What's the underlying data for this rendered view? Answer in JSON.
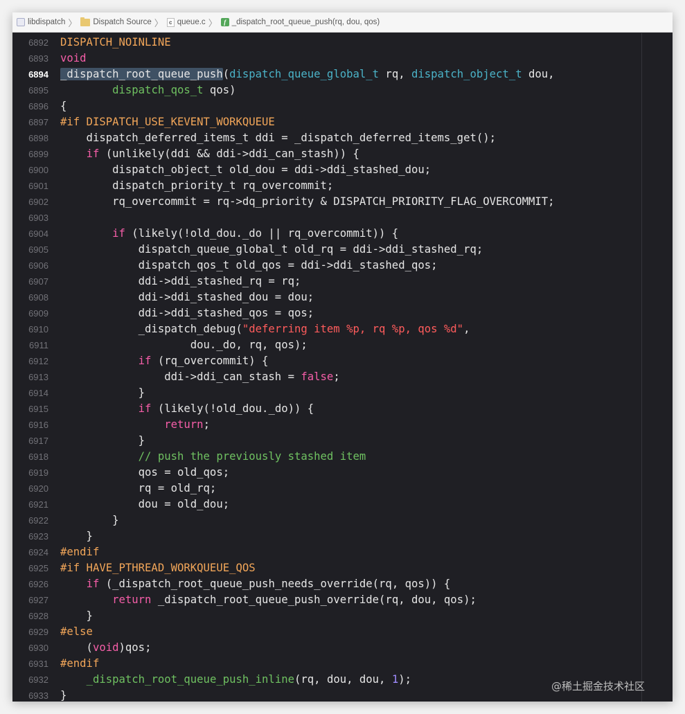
{
  "breadcrumb": {
    "items": [
      {
        "label": "libdispatch",
        "icon": "project-icon"
      },
      {
        "label": "Dispatch Source",
        "icon": "folder-icon"
      },
      {
        "label": "queue.c",
        "icon": "c-file-icon",
        "badge": "c"
      },
      {
        "label": "_dispatch_root_queue_push(rq, dou, qos)",
        "icon": "function-icon",
        "badge": "f"
      }
    ]
  },
  "colors": {
    "keyword": "#f55ea8",
    "preprocessor": "#f2a659",
    "string": "#ff5c5c",
    "comment": "#6fc161",
    "type": "#4bb3c8",
    "number": "#a08cff",
    "plain": "#e6e6e6",
    "background": "#1f1f24"
  },
  "editor": {
    "current_line": "6894",
    "lines": [
      {
        "n": "6892",
        "t": [
          [
            "pp",
            "DISPATCH_NOINLINE"
          ]
        ]
      },
      {
        "n": "6893",
        "t": [
          [
            "kw",
            "void"
          ]
        ]
      },
      {
        "n": "6894",
        "t": [
          [
            "hl",
            "_dispatch_root_queue_push"
          ],
          [
            "p",
            "("
          ],
          [
            "typ",
            "dispatch_queue_global_t"
          ],
          [
            "p",
            " rq, "
          ],
          [
            "typ",
            "dispatch_object_t"
          ],
          [
            "p",
            " dou,"
          ]
        ]
      },
      {
        "n": "6895",
        "t": [
          [
            "p",
            "        "
          ],
          [
            "cmt",
            "dispatch_qos_t"
          ],
          [
            "p",
            " qos)"
          ]
        ]
      },
      {
        "n": "6896",
        "t": [
          [
            "p",
            "{"
          ]
        ]
      },
      {
        "n": "6897",
        "t": [
          [
            "pp",
            "#if DISPATCH_USE_KEVENT_WORKQUEUE"
          ]
        ]
      },
      {
        "n": "6898",
        "t": [
          [
            "p",
            "    dispatch_deferred_items_t ddi = _dispatch_deferred_items_get();"
          ]
        ]
      },
      {
        "n": "6899",
        "t": [
          [
            "p",
            "    "
          ],
          [
            "kw",
            "if"
          ],
          [
            "p",
            " (unlikely(ddi && ddi->ddi_can_stash)) {"
          ]
        ]
      },
      {
        "n": "6900",
        "t": [
          [
            "p",
            "        dispatch_object_t old_dou = ddi->ddi_stashed_dou;"
          ]
        ]
      },
      {
        "n": "6901",
        "t": [
          [
            "p",
            "        dispatch_priority_t rq_overcommit;"
          ]
        ]
      },
      {
        "n": "6902",
        "t": [
          [
            "p",
            "        rq_overcommit = rq->dq_priority & DISPATCH_PRIORITY_FLAG_OVERCOMMIT;"
          ]
        ]
      },
      {
        "n": "6903",
        "t": [
          [
            "p",
            ""
          ]
        ]
      },
      {
        "n": "6904",
        "t": [
          [
            "p",
            "        "
          ],
          [
            "kw",
            "if"
          ],
          [
            "p",
            " (likely(!old_dou._do || rq_overcommit)) {"
          ]
        ]
      },
      {
        "n": "6905",
        "t": [
          [
            "p",
            "            dispatch_queue_global_t old_rq = ddi->ddi_stashed_rq;"
          ]
        ]
      },
      {
        "n": "6906",
        "t": [
          [
            "p",
            "            dispatch_qos_t old_qos = ddi->ddi_stashed_qos;"
          ]
        ]
      },
      {
        "n": "6907",
        "t": [
          [
            "p",
            "            ddi->ddi_stashed_rq = rq;"
          ]
        ]
      },
      {
        "n": "6908",
        "t": [
          [
            "p",
            "            ddi->ddi_stashed_dou = dou;"
          ]
        ]
      },
      {
        "n": "6909",
        "t": [
          [
            "p",
            "            ddi->ddi_stashed_qos = qos;"
          ]
        ]
      },
      {
        "n": "6910",
        "t": [
          [
            "p",
            "            _dispatch_debug("
          ],
          [
            "str",
            "\"deferring item %p, rq %p, qos %d\""
          ],
          [
            "p",
            ","
          ]
        ]
      },
      {
        "n": "6911",
        "t": [
          [
            "p",
            "                    dou._do, rq, qos);"
          ]
        ]
      },
      {
        "n": "6912",
        "t": [
          [
            "p",
            "            "
          ],
          [
            "kw",
            "if"
          ],
          [
            "p",
            " (rq_overcommit) {"
          ]
        ]
      },
      {
        "n": "6913",
        "t": [
          [
            "p",
            "                ddi->ddi_can_stash = "
          ],
          [
            "kw",
            "false"
          ],
          [
            "p",
            ";"
          ]
        ]
      },
      {
        "n": "6914",
        "t": [
          [
            "p",
            "            }"
          ]
        ]
      },
      {
        "n": "6915",
        "t": [
          [
            "p",
            "            "
          ],
          [
            "kw",
            "if"
          ],
          [
            "p",
            " (likely(!old_dou._do)) {"
          ]
        ]
      },
      {
        "n": "6916",
        "t": [
          [
            "p",
            "                "
          ],
          [
            "kw",
            "return"
          ],
          [
            "p",
            ";"
          ]
        ]
      },
      {
        "n": "6917",
        "t": [
          [
            "p",
            "            }"
          ]
        ]
      },
      {
        "n": "6918",
        "t": [
          [
            "p",
            "            "
          ],
          [
            "cmt",
            "// push the previously stashed item"
          ]
        ]
      },
      {
        "n": "6919",
        "t": [
          [
            "p",
            "            qos = old_qos;"
          ]
        ]
      },
      {
        "n": "6920",
        "t": [
          [
            "p",
            "            rq = old_rq;"
          ]
        ]
      },
      {
        "n": "6921",
        "t": [
          [
            "p",
            "            dou = old_dou;"
          ]
        ]
      },
      {
        "n": "6922",
        "t": [
          [
            "p",
            "        }"
          ]
        ]
      },
      {
        "n": "6923",
        "t": [
          [
            "p",
            "    }"
          ]
        ]
      },
      {
        "n": "6924",
        "t": [
          [
            "pp",
            "#endif"
          ]
        ]
      },
      {
        "n": "6925",
        "t": [
          [
            "pp",
            "#if HAVE_PTHREAD_WORKQUEUE_QOS"
          ]
        ]
      },
      {
        "n": "6926",
        "t": [
          [
            "p",
            "    "
          ],
          [
            "kw",
            "if"
          ],
          [
            "p",
            " (_dispatch_root_queue_push_needs_override(rq, qos)) {"
          ]
        ]
      },
      {
        "n": "6927",
        "t": [
          [
            "p",
            "        "
          ],
          [
            "kw",
            "return"
          ],
          [
            "p",
            " _dispatch_root_queue_push_override(rq, dou, qos);"
          ]
        ]
      },
      {
        "n": "6928",
        "t": [
          [
            "p",
            "    }"
          ]
        ]
      },
      {
        "n": "6929",
        "t": [
          [
            "pp",
            "#else"
          ]
        ]
      },
      {
        "n": "6930",
        "t": [
          [
            "p",
            "    ("
          ],
          [
            "kw",
            "void"
          ],
          [
            "p",
            ")qos;"
          ]
        ]
      },
      {
        "n": "6931",
        "t": [
          [
            "pp",
            "#endif"
          ]
        ]
      },
      {
        "n": "6932",
        "t": [
          [
            "p",
            "    "
          ],
          [
            "cmt",
            "_dispatch_root_queue_push_inline"
          ],
          [
            "p",
            "(rq, dou, dou, "
          ],
          [
            "num",
            "1"
          ],
          [
            "p",
            ");"
          ]
        ]
      },
      {
        "n": "6933",
        "t": [
          [
            "p",
            "}"
          ]
        ]
      }
    ]
  },
  "watermark": "@稀土掘金技术社区"
}
